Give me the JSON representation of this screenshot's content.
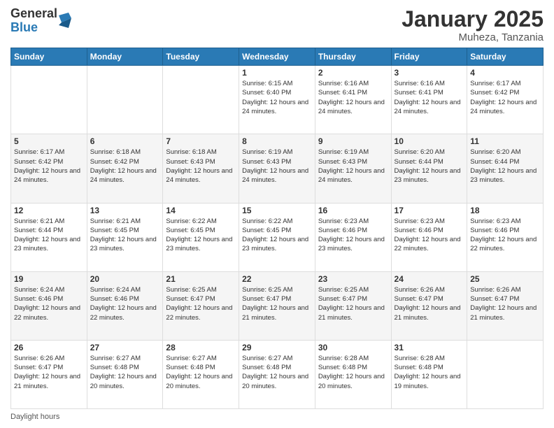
{
  "header": {
    "logo": {
      "general": "General",
      "blue": "Blue"
    },
    "title": "January 2025",
    "location": "Muheza, Tanzania"
  },
  "days_of_week": [
    "Sunday",
    "Monday",
    "Tuesday",
    "Wednesday",
    "Thursday",
    "Friday",
    "Saturday"
  ],
  "weeks": [
    [
      {
        "day": "",
        "info": ""
      },
      {
        "day": "",
        "info": ""
      },
      {
        "day": "",
        "info": ""
      },
      {
        "day": "1",
        "info": "Sunrise: 6:15 AM\nSunset: 6:40 PM\nDaylight: 12 hours\nand 24 minutes."
      },
      {
        "day": "2",
        "info": "Sunrise: 6:16 AM\nSunset: 6:41 PM\nDaylight: 12 hours\nand 24 minutes."
      },
      {
        "day": "3",
        "info": "Sunrise: 6:16 AM\nSunset: 6:41 PM\nDaylight: 12 hours\nand 24 minutes."
      },
      {
        "day": "4",
        "info": "Sunrise: 6:17 AM\nSunset: 6:42 PM\nDaylight: 12 hours\nand 24 minutes."
      }
    ],
    [
      {
        "day": "5",
        "info": "Sunrise: 6:17 AM\nSunset: 6:42 PM\nDaylight: 12 hours\nand 24 minutes."
      },
      {
        "day": "6",
        "info": "Sunrise: 6:18 AM\nSunset: 6:42 PM\nDaylight: 12 hours\nand 24 minutes."
      },
      {
        "day": "7",
        "info": "Sunrise: 6:18 AM\nSunset: 6:43 PM\nDaylight: 12 hours\nand 24 minutes."
      },
      {
        "day": "8",
        "info": "Sunrise: 6:19 AM\nSunset: 6:43 PM\nDaylight: 12 hours\nand 24 minutes."
      },
      {
        "day": "9",
        "info": "Sunrise: 6:19 AM\nSunset: 6:43 PM\nDaylight: 12 hours\nand 24 minutes."
      },
      {
        "day": "10",
        "info": "Sunrise: 6:20 AM\nSunset: 6:44 PM\nDaylight: 12 hours\nand 23 minutes."
      },
      {
        "day": "11",
        "info": "Sunrise: 6:20 AM\nSunset: 6:44 PM\nDaylight: 12 hours\nand 23 minutes."
      }
    ],
    [
      {
        "day": "12",
        "info": "Sunrise: 6:21 AM\nSunset: 6:44 PM\nDaylight: 12 hours\nand 23 minutes."
      },
      {
        "day": "13",
        "info": "Sunrise: 6:21 AM\nSunset: 6:45 PM\nDaylight: 12 hours\nand 23 minutes."
      },
      {
        "day": "14",
        "info": "Sunrise: 6:22 AM\nSunset: 6:45 PM\nDaylight: 12 hours\nand 23 minutes."
      },
      {
        "day": "15",
        "info": "Sunrise: 6:22 AM\nSunset: 6:45 PM\nDaylight: 12 hours\nand 23 minutes."
      },
      {
        "day": "16",
        "info": "Sunrise: 6:23 AM\nSunset: 6:46 PM\nDaylight: 12 hours\nand 23 minutes."
      },
      {
        "day": "17",
        "info": "Sunrise: 6:23 AM\nSunset: 6:46 PM\nDaylight: 12 hours\nand 22 minutes."
      },
      {
        "day": "18",
        "info": "Sunrise: 6:23 AM\nSunset: 6:46 PM\nDaylight: 12 hours\nand 22 minutes."
      }
    ],
    [
      {
        "day": "19",
        "info": "Sunrise: 6:24 AM\nSunset: 6:46 PM\nDaylight: 12 hours\nand 22 minutes."
      },
      {
        "day": "20",
        "info": "Sunrise: 6:24 AM\nSunset: 6:46 PM\nDaylight: 12 hours\nand 22 minutes."
      },
      {
        "day": "21",
        "info": "Sunrise: 6:25 AM\nSunset: 6:47 PM\nDaylight: 12 hours\nand 22 minutes."
      },
      {
        "day": "22",
        "info": "Sunrise: 6:25 AM\nSunset: 6:47 PM\nDaylight: 12 hours\nand 21 minutes."
      },
      {
        "day": "23",
        "info": "Sunrise: 6:25 AM\nSunset: 6:47 PM\nDaylight: 12 hours\nand 21 minutes."
      },
      {
        "day": "24",
        "info": "Sunrise: 6:26 AM\nSunset: 6:47 PM\nDaylight: 12 hours\nand 21 minutes."
      },
      {
        "day": "25",
        "info": "Sunrise: 6:26 AM\nSunset: 6:47 PM\nDaylight: 12 hours\nand 21 minutes."
      }
    ],
    [
      {
        "day": "26",
        "info": "Sunrise: 6:26 AM\nSunset: 6:47 PM\nDaylight: 12 hours\nand 21 minutes."
      },
      {
        "day": "27",
        "info": "Sunrise: 6:27 AM\nSunset: 6:48 PM\nDaylight: 12 hours\nand 20 minutes."
      },
      {
        "day": "28",
        "info": "Sunrise: 6:27 AM\nSunset: 6:48 PM\nDaylight: 12 hours\nand 20 minutes."
      },
      {
        "day": "29",
        "info": "Sunrise: 6:27 AM\nSunset: 6:48 PM\nDaylight: 12 hours\nand 20 minutes."
      },
      {
        "day": "30",
        "info": "Sunrise: 6:28 AM\nSunset: 6:48 PM\nDaylight: 12 hours\nand 20 minutes."
      },
      {
        "day": "31",
        "info": "Sunrise: 6:28 AM\nSunset: 6:48 PM\nDaylight: 12 hours\nand 19 minutes."
      },
      {
        "day": "",
        "info": ""
      }
    ]
  ],
  "footer": {
    "daylight_label": "Daylight hours"
  }
}
